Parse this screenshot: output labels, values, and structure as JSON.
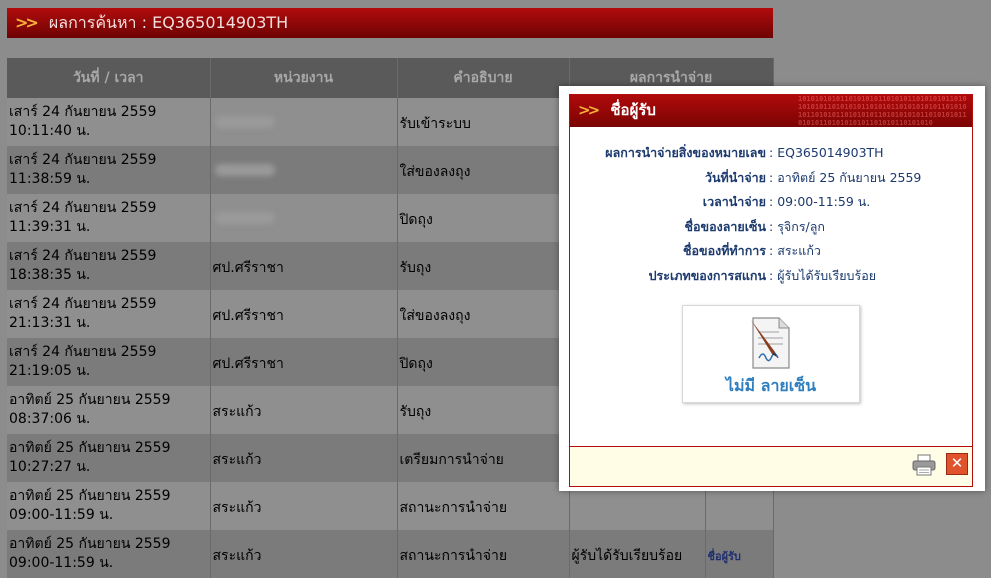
{
  "header": {
    "title": "ผลการค้นหา : EQ365014903TH"
  },
  "table": {
    "columns": [
      "วันที่ / เวลา",
      "หน่วยงาน",
      "คำอธิบาย",
      "ผลการนำจ่าย"
    ],
    "rows": [
      {
        "date": "เสาร์ 24 กันยายน 2559",
        "time": "10:11:40 น.",
        "office": "",
        "desc": "รับเข้าระบบ",
        "result": "",
        "link": ""
      },
      {
        "date": "เสาร์ 24 กันยายน 2559",
        "time": "11:38:59 น.",
        "office": "",
        "desc": "ใส่ของลงถุง",
        "result": "",
        "link": ""
      },
      {
        "date": "เสาร์ 24 กันยายน 2559",
        "time": "11:39:31 น.",
        "office": "",
        "desc": "ปิดถุง",
        "result": "",
        "link": ""
      },
      {
        "date": "เสาร์ 24 กันยายน 2559",
        "time": "18:38:35 น.",
        "office": "ศป.ศรีราชา",
        "desc": "รับถุง",
        "result": "",
        "link": ""
      },
      {
        "date": "เสาร์ 24 กันยายน 2559",
        "time": "21:13:31 น.",
        "office": "ศป.ศรีราชา",
        "desc": "ใส่ของลงถุง",
        "result": "",
        "link": ""
      },
      {
        "date": "เสาร์ 24 กันยายน 2559",
        "time": "21:19:05 น.",
        "office": "ศป.ศรีราชา",
        "desc": "ปิดถุง",
        "result": "",
        "link": ""
      },
      {
        "date": "อาทิตย์ 25 กันยายน 2559",
        "time": "08:37:06 น.",
        "office": "สระแก้ว",
        "desc": "รับถุง",
        "result": "",
        "link": ""
      },
      {
        "date": "อาทิตย์ 25 กันยายน 2559",
        "time": "10:27:27 น.",
        "office": "สระแก้ว",
        "desc": "เตรียมการนำจ่าย",
        "result": "",
        "link": ""
      },
      {
        "date": "อาทิตย์ 25 กันยายน 2559",
        "time": "09:00-11:59 น.",
        "office": "สระแก้ว",
        "desc": "สถานะการนำจ่าย",
        "result": "",
        "link": ""
      },
      {
        "date": "อาทิตย์ 25 กันยายน 2559",
        "time": "09:00-11:59 น.",
        "office": "สระแก้ว",
        "desc": "สถานะการนำจ่าย",
        "result": "ผู้รับได้รับเรียบร้อย",
        "link": "ชื่อผู้รับ"
      }
    ]
  },
  "popup": {
    "title": "ชื่อผู้รับ",
    "fields": [
      {
        "label": "ผลการนำจ่ายสิ่งของหมายเลข",
        "value": "EQ365014903TH"
      },
      {
        "label": "วันที่นำจ่าย",
        "value": "อาทิตย์ 25 กันยายน 2559"
      },
      {
        "label": "เวลานำจ่าย",
        "value": "09:00-11:59 น."
      },
      {
        "label": "ชื่อของลายเซ็น",
        "value": "รุจิกร/ลูก"
      },
      {
        "label": "ชื่อของที่ทำการ",
        "value": "สระแก้ว"
      },
      {
        "label": "ประเภทของการสแกน",
        "value": "ผู้รับได้รับเรียบร้อย"
      }
    ],
    "signature_text": "ไม่มี ลายเซ็น",
    "close_symbol": "✕",
    "binary_pattern": "10101010101101010101101010110101010110101010101101010101101010110101010101101010101101010110101010110101010101101010101101010110101010101101010110101010"
  },
  "colors": {
    "header_red": "#b10c0c",
    "accent_orange": "#f6b23a",
    "popup_text": "#1c3a6e"
  },
  "icons": [
    "double-chevron-icon",
    "document-signature-icon",
    "printer-icon",
    "close-icon"
  ]
}
